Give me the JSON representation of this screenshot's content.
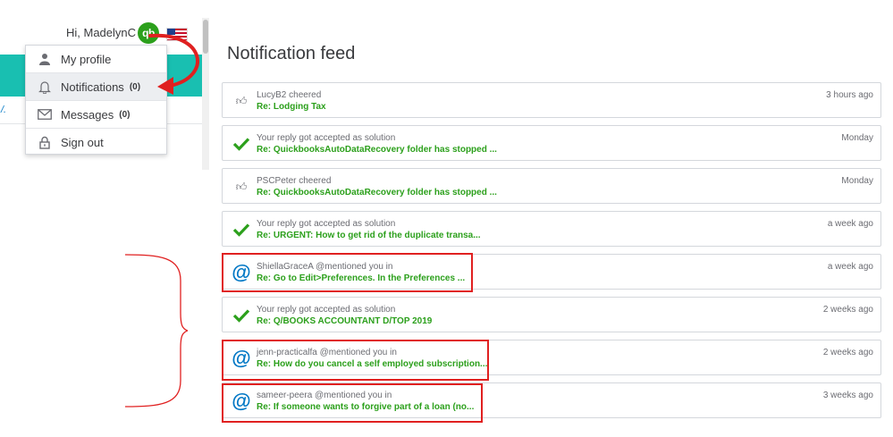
{
  "header": {
    "greeting": "Hi, MadelynC",
    "logo_text": "qb"
  },
  "left": {
    "fragment": "/."
  },
  "dropdown": {
    "items": [
      {
        "label": "My profile",
        "icon": "person-icon",
        "count": ""
      },
      {
        "label": "Notifications",
        "icon": "bell-icon",
        "count": "(0)"
      },
      {
        "label": "Messages",
        "icon": "envelope-icon",
        "count": "(0)"
      },
      {
        "label": "Sign out",
        "icon": "lock-icon",
        "count": ""
      }
    ]
  },
  "feed": {
    "title": "Notification feed",
    "items": [
      {
        "icon": "thumbs-up-icon",
        "message": "LucyB2 cheered",
        "link": "Re: Lodging Tax",
        "time": "3 hours ago"
      },
      {
        "icon": "check-icon",
        "message": "Your reply got accepted as solution",
        "link": "Re: QuickbooksAutoDataRecovery folder has stopped ...",
        "time": "Monday"
      },
      {
        "icon": "thumbs-up-icon",
        "message": "PSCPeter cheered",
        "link": "Re: QuickbooksAutoDataRecovery folder has stopped ...",
        "time": "Monday"
      },
      {
        "icon": "check-icon",
        "message": "Your reply got accepted as solution",
        "link": "Re: URGENT: How to get rid of the duplicate transa...",
        "time": "a week ago"
      },
      {
        "icon": "at-icon",
        "message": "ShiellaGraceA @mentioned you in",
        "link": "Re: Go to Edit>Preferences. In the Preferences ...",
        "time": "a week ago"
      },
      {
        "icon": "check-icon",
        "message": "Your reply got accepted as solution",
        "link": "Re: Q/BOOKS ACCOUNTANT D/TOP 2019",
        "time": "2 weeks ago"
      },
      {
        "icon": "at-icon",
        "message": "jenn-practicalfa @mentioned you in",
        "link": "Re: How do you cancel a self employed subscription...",
        "time": "2 weeks ago"
      },
      {
        "icon": "at-icon",
        "message": "sameer-peera @mentioned you in",
        "link": "Re: If someone wants to forgive part of a loan (no...",
        "time": "3 weeks ago"
      }
    ]
  },
  "colors": {
    "brand_green": "#2ca01c",
    "teal": "#19bfb1",
    "annotation_red": "#e02020",
    "mention_blue": "#0077c5"
  }
}
